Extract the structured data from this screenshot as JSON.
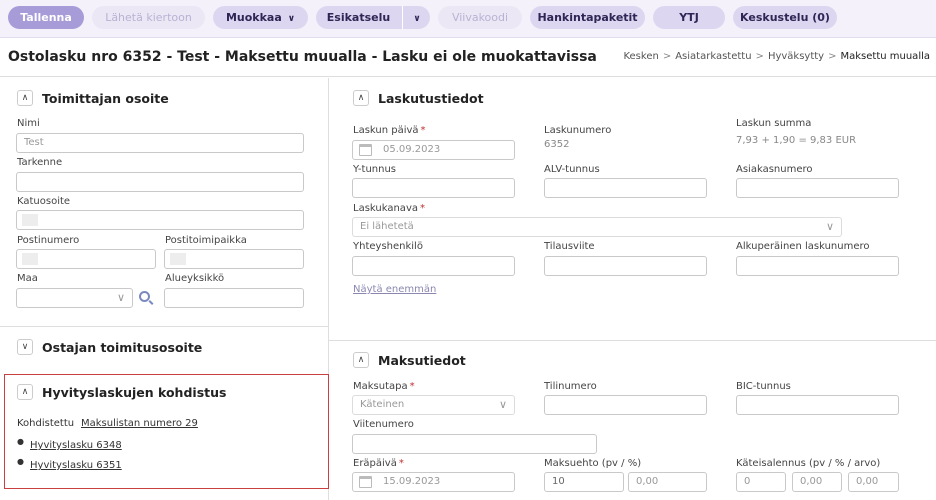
{
  "toolbar": {
    "save": "Tallenna",
    "send_round": "Lähetä kiertoon",
    "edit": "Muokkaa",
    "preview": "Esikatselu",
    "barcode": "Viivakoodi",
    "procurement": "Hankintapaketit",
    "ytj": "YTJ",
    "discussion": "Keskustelu (0)"
  },
  "header": {
    "title": "Ostolasku nro 6352 - Test - Maksettu muualla - Lasku ei ole muokattavissa",
    "breadcrumb": [
      "Kesken",
      "Asiatarkastettu",
      "Hyväksytty",
      "Maksettu muualla"
    ]
  },
  "supplier_address": {
    "title": "Toimittajan osoite",
    "name_label": "Nimi",
    "name_value": "Test",
    "extra_label": "Tarkenne",
    "street_label": "Katuosoite",
    "postcode_label": "Postinumero",
    "city_label": "Postitoimipaikka",
    "country_label": "Maa",
    "region_label": "Alueyksikkö"
  },
  "buyer_delivery": {
    "title": "Ostajan toimitusosoite"
  },
  "credit_notes": {
    "title": "Hyvityslaskujen kohdistus",
    "allocated_label": "Kohdistettu",
    "allocated_link": "Maksulistan numero 29",
    "items": [
      "Hyvityslasku 6348",
      "Hyvityslasku 6351"
    ]
  },
  "invoice_info": {
    "title": "Laskutustiedot",
    "date_label": "Laskun päivä",
    "date_value": "05.09.2023",
    "number_label": "Laskunumero",
    "number_value": "6352",
    "sum_label": "Laskun summa",
    "sum_value": "7,93 + 1,90 = 9,83 EUR",
    "business_id_label": "Y-tunnus",
    "vat_id_label": "ALV-tunnus",
    "customer_no_label": "Asiakasnumero",
    "channel_label": "Laskukanava",
    "channel_value": "Ei lähetetä",
    "contact_label": "Yhteyshenkilö",
    "order_ref_label": "Tilausviite",
    "original_no_label": "Alkuperäinen laskunumero",
    "show_more": "Näytä enemmän"
  },
  "payment_info": {
    "title": "Maksutiedot",
    "method_label": "Maksutapa",
    "method_value": "Käteinen",
    "account_label": "Tilinumero",
    "bic_label": "BIC-tunnus",
    "reference_label": "Viitenumero",
    "due_label": "Eräpäivä",
    "due_value": "15.09.2023",
    "terms_label": "Maksuehto (pv / %)",
    "terms_days": "10",
    "terms_pct": "0,00",
    "discount_label": "Käteisalennus (pv / % / arvo)",
    "discount_days": "0",
    "discount_pct": "0,00",
    "discount_value": "0,00"
  }
}
